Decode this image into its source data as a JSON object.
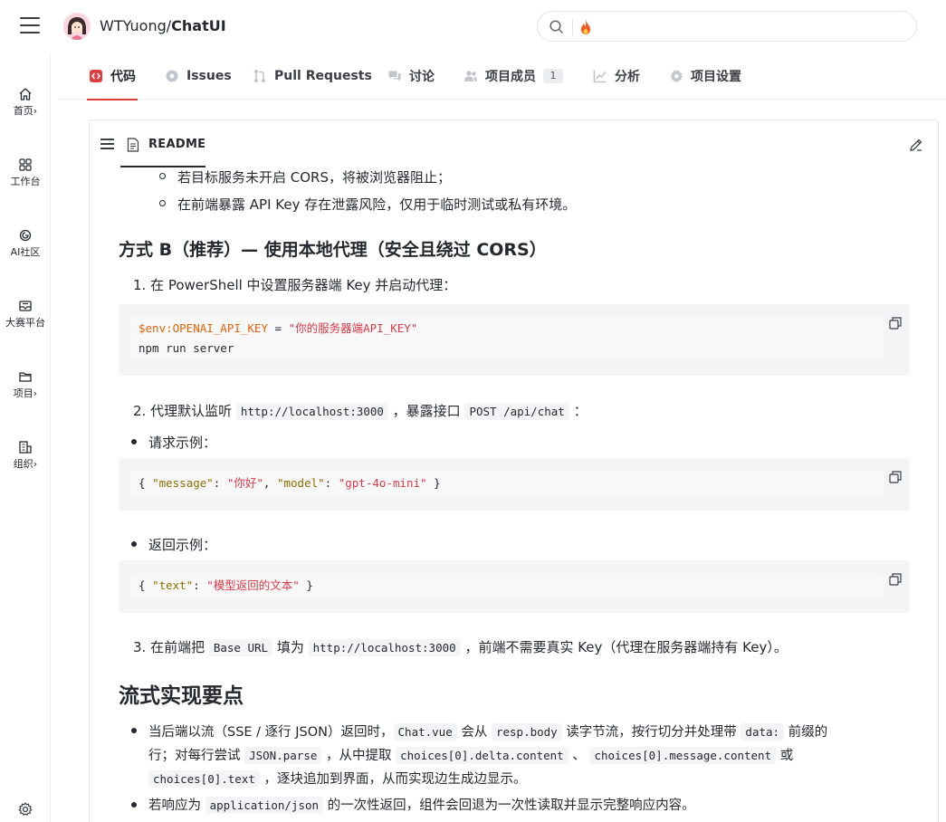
{
  "header": {
    "owner": "WTYuong/",
    "repo": "ChatUI",
    "search_placeholder": ""
  },
  "sidebar": {
    "items": [
      {
        "label": "首页",
        "icon": "home-icon",
        "chevron": "›"
      },
      {
        "label": "工作台",
        "icon": "grid-icon",
        "chevron": ""
      },
      {
        "label": "AI社区",
        "icon": "ai-icon",
        "chevron": ""
      },
      {
        "label": "大赛平台",
        "icon": "contest-icon",
        "chevron": ""
      },
      {
        "label": "项目",
        "icon": "folder-icon",
        "chevron": "›"
      },
      {
        "label": "组织",
        "icon": "org-icon",
        "chevron": "›"
      }
    ]
  },
  "tabs": [
    {
      "label": "代码",
      "icon": "code-icon"
    },
    {
      "label": "Issues",
      "icon": "issue-icon"
    },
    {
      "label": "Pull Requests",
      "icon": "pr-icon"
    },
    {
      "label": "讨论",
      "icon": "discussion-icon"
    },
    {
      "label": "项目成员",
      "icon": "members-icon",
      "badge": "1"
    },
    {
      "label": "分析",
      "icon": "chart-icon"
    },
    {
      "label": "项目设置",
      "icon": "gear-icon"
    }
  ],
  "readme": {
    "title": "README",
    "sub_bullets": [
      "若目标服务未开启 CORS，将被浏览器阻止；",
      "在前端暴露 API Key 存在泄露风险，仅用于临时测试或私有环境。"
    ],
    "heading_b": "方式 B（推荐）— 使用本地代理（安全且绕过 CORS）",
    "step1": "1. 在 PowerShell 中设置服务器端 Key 并启动代理：",
    "code1": {
      "var": "$env:OPENAI_API_KEY",
      "eq": " = ",
      "str": "\"你的服务器端API_KEY\"",
      "line2": "npm run server"
    },
    "step2": {
      "prefix": "2. 代理默认监听 ",
      "code_a": "http://localhost:3000",
      "mid": " ，暴露接口 ",
      "code_b": "POST /api/chat",
      "suffix": " ："
    },
    "req_label": "请求示例：",
    "code2": {
      "open": "{ ",
      "k1": "\"message\"",
      "c1": ": ",
      "v1": "\"你好\"",
      "sep": ", ",
      "k2": "\"model\"",
      "c2": ": ",
      "v2": "\"gpt-4o-mini\"",
      "close": " }"
    },
    "resp_label": "返回示例：",
    "code3": {
      "open": "{ ",
      "k1": "\"text\"",
      "c1": ": ",
      "v1": "\"模型返回的文本\"",
      "close": " }"
    },
    "step3": {
      "prefix": "3. 在前端把 ",
      "code_a": "Base URL",
      "mid": " 填为 ",
      "code_b": "http://localhost:3000",
      "suffix": " ，前端不需要真实 Key（代理在服务器端持有 Key）。"
    },
    "heading_stream": "流式实现要点",
    "stream_b1": {
      "t1": "当后端以流（SSE / 逐行 JSON）返回时，",
      "c1": "Chat.vue",
      "t2": " 会从 ",
      "c2": "resp.body",
      "t3": " 读字节流，按行切分并处理带 ",
      "c3": "data:",
      "t4": " 前缀的",
      "t5": "行；对每行尝试 ",
      "c4": "JSON.parse",
      "t6": " ，从中提取 ",
      "c5": "choices[0].delta.content",
      "t7": " 、 ",
      "c6": "choices[0].message.content",
      "t8": " 或",
      "c7": "choices[0].text",
      "t9": " ，逐块追加到界面，从而实现边生成边显示。"
    },
    "stream_b2": {
      "t1": "若响应为 ",
      "c1": "application/json",
      "t2": " 的一次性返回，组件会回退为一次性读取并显示完整响应内容。"
    }
  },
  "colors": {
    "accent": "#e23d3d",
    "code_var": "#e36209",
    "code_str": "#d73a49",
    "code_key": "#8b6d00"
  }
}
